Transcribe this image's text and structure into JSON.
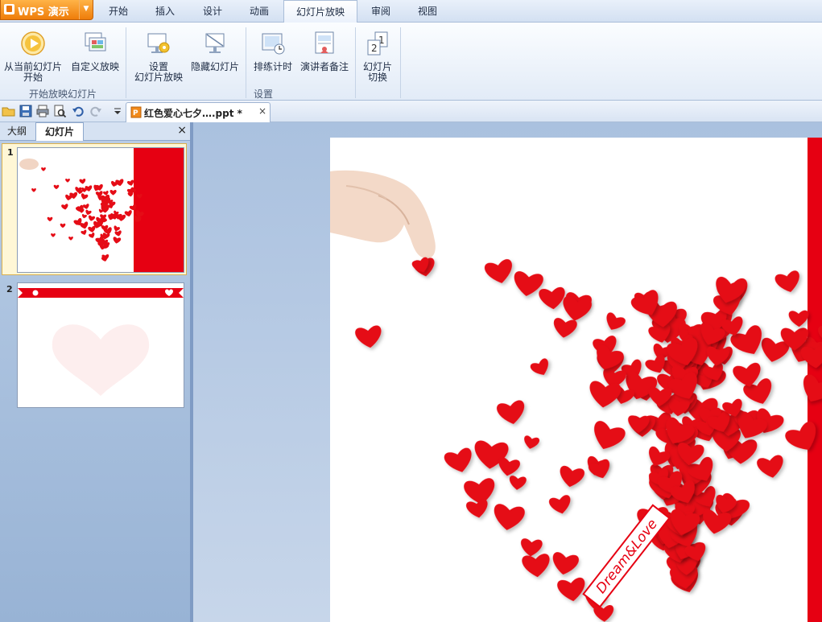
{
  "app": {
    "name": "WPS 演示"
  },
  "menu_tabs": [
    "开始",
    "插入",
    "设计",
    "动画",
    "幻灯片放映",
    "审阅",
    "视图"
  ],
  "ribbon": {
    "from_current_line1": "从当前幻灯片",
    "from_current_line2": "开始",
    "custom_show": "自定义放映",
    "setup_line1": "设置",
    "setup_line2": "幻灯片放映",
    "hide_slide": "隐藏幻灯片",
    "rehearse": "排练计时",
    "speaker_notes": "演讲者备注",
    "transition_line1": "幻灯片",
    "transition_line2": "切换",
    "group_start": "开始放映幻灯片",
    "group_setup": "设置"
  },
  "document": {
    "tab_title": "红色爱心七夕….ppt *",
    "close": "×"
  },
  "panel": {
    "tab_outline": "大纲",
    "tab_slides": "幻灯片",
    "close": "×",
    "slides": [
      {
        "number": "1"
      },
      {
        "number": "2"
      }
    ]
  },
  "slide": {
    "ribbon_text": "Dream&Love"
  },
  "colors": {
    "accent_red": "#e60012",
    "app_orange": "#ef7d0a"
  }
}
